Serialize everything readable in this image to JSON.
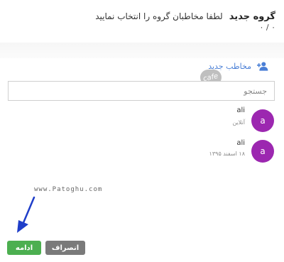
{
  "header": {
    "title": "گروه جدید",
    "subtitle": "لطفا مخاطبان گروه را انتخاب نمایید",
    "counter": "۰ / ۰"
  },
  "new_contact": {
    "label": "مخاطب جدید",
    "icon": "person-add-icon",
    "color": "#4a7fd6"
  },
  "watermark": {
    "logo_text": "cafe",
    "site_text": "www.Patoghu.com"
  },
  "search": {
    "placeholder": "جستجو",
    "value": ""
  },
  "contacts": [
    {
      "avatar_letter": "a",
      "name": "ali",
      "status": "آنلاین",
      "avatar_color": "#9c27b0"
    },
    {
      "avatar_letter": "a",
      "name": "ali",
      "status": "۱۸ اسفند ۱۳۹۵",
      "avatar_color": "#9c27b0"
    }
  ],
  "buttons": {
    "continue_label": "ادامه",
    "cancel_label": "انصراف",
    "continue_color": "#4caf50",
    "cancel_color": "#7a7a7a"
  }
}
